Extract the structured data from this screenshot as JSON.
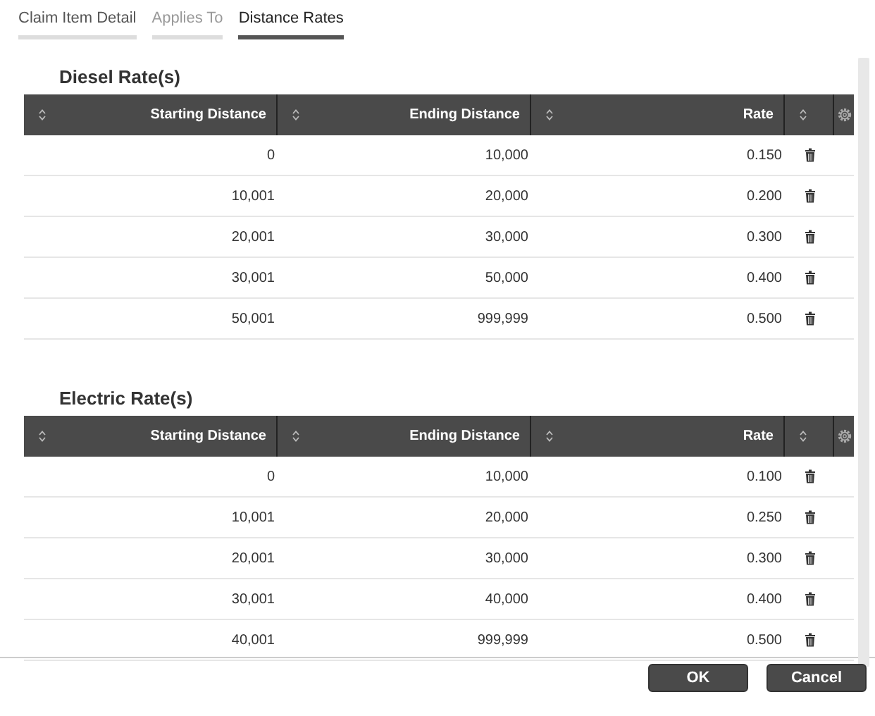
{
  "tabs": [
    {
      "label": "Claim Item Detail",
      "selected": false
    },
    {
      "label": "Applies To",
      "selected": false
    },
    {
      "label": "Distance Rates",
      "selected": true
    }
  ],
  "sections": [
    {
      "title": "Diesel Rate(s)",
      "columns": [
        "Starting Distance",
        "Ending Distance",
        "Rate"
      ],
      "rows": [
        [
          "0",
          "10,000",
          "0.150"
        ],
        [
          "10,001",
          "20,000",
          "0.200"
        ],
        [
          "20,001",
          "30,000",
          "0.300"
        ],
        [
          "30,001",
          "50,000",
          "0.400"
        ],
        [
          "50,001",
          "999,999",
          "0.500"
        ]
      ]
    },
    {
      "title": "Electric Rate(s)",
      "columns": [
        "Starting Distance",
        "Ending Distance",
        "Rate"
      ],
      "rows": [
        [
          "0",
          "10,000",
          "0.100"
        ],
        [
          "10,001",
          "20,000",
          "0.250"
        ],
        [
          "20,001",
          "30,000",
          "0.300"
        ],
        [
          "30,001",
          "40,000",
          "0.400"
        ],
        [
          "40,001",
          "999,999",
          "0.500"
        ]
      ]
    }
  ],
  "buttons": [
    "OK",
    "Cancel"
  ]
}
